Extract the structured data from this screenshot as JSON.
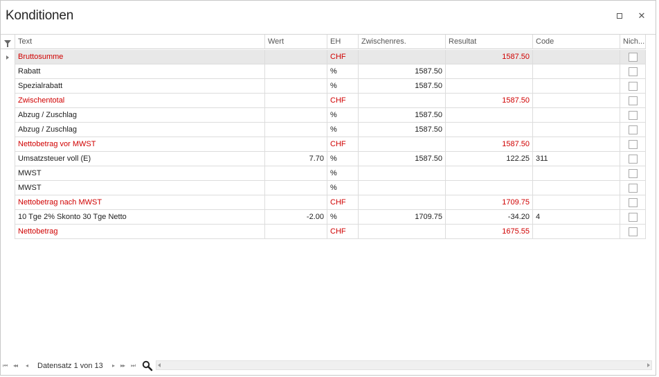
{
  "window": {
    "title": "Konditionen",
    "maximize_icon": "maximize-icon",
    "close_label": "✕"
  },
  "grid": {
    "columns": {
      "text": "Text",
      "wert": "Wert",
      "eh": "EH",
      "zwischenres": "Zwischenres.",
      "resultat": "Resultat",
      "code": "Code",
      "nich": "Nich..."
    },
    "highlight_color": "#d00000",
    "rows": [
      {
        "text": "Bruttosumme",
        "wert": "",
        "eh": "CHF",
        "zw": "",
        "res": "1587.50",
        "code": "",
        "checked": false,
        "highlight": true
      },
      {
        "text": "Rabatt",
        "wert": "",
        "eh": "%",
        "zw": "1587.50",
        "res": "",
        "code": "",
        "checked": false,
        "highlight": false
      },
      {
        "text": "Spezialrabatt",
        "wert": "",
        "eh": "%",
        "zw": "1587.50",
        "res": "",
        "code": "",
        "checked": false,
        "highlight": false
      },
      {
        "text": "Zwischentotal",
        "wert": "",
        "eh": "CHF",
        "zw": "",
        "res": "1587.50",
        "code": "",
        "checked": false,
        "highlight": true
      },
      {
        "text": "Abzug / Zuschlag",
        "wert": "",
        "eh": "%",
        "zw": "1587.50",
        "res": "",
        "code": "",
        "checked": false,
        "highlight": false
      },
      {
        "text": "Abzug / Zuschlag",
        "wert": "",
        "eh": "%",
        "zw": "1587.50",
        "res": "",
        "code": "",
        "checked": false,
        "highlight": false
      },
      {
        "text": "Nettobetrag vor MWST",
        "wert": "",
        "eh": "CHF",
        "zw": "",
        "res": "1587.50",
        "code": "",
        "checked": false,
        "highlight": true
      },
      {
        "text": "Umsatzsteuer voll (E)",
        "wert": "7.70",
        "eh": "%",
        "zw": "1587.50",
        "res": "122.25",
        "code": "311",
        "checked": false,
        "highlight": false
      },
      {
        "text": "MWST",
        "wert": "",
        "eh": "%",
        "zw": "",
        "res": "",
        "code": "",
        "checked": false,
        "highlight": false
      },
      {
        "text": "MWST",
        "wert": "",
        "eh": "%",
        "zw": "",
        "res": "",
        "code": "",
        "checked": false,
        "highlight": false
      },
      {
        "text": "Nettobetrag nach MWST",
        "wert": "",
        "eh": "CHF",
        "zw": "",
        "res": "1709.75",
        "code": "",
        "checked": false,
        "highlight": true
      },
      {
        "text": "10 Tge 2% Skonto 30 Tge Netto",
        "wert": "-2.00",
        "eh": "%",
        "zw": "1709.75",
        "res": "-34.20",
        "code": "4",
        "checked": false,
        "highlight": false
      },
      {
        "text": "Nettobetrag",
        "wert": "",
        "eh": "CHF",
        "zw": "",
        "res": "1675.55",
        "code": "",
        "checked": false,
        "highlight": true
      }
    ],
    "selected_row": 0
  },
  "footer": {
    "record_label": "Datensatz 1 von 13",
    "nav_first": "⏮",
    "nav_prev_page": "◂◂",
    "nav_prev": "◂",
    "nav_next": "▸",
    "nav_next_page": "▸▸",
    "nav_last": "⏭"
  }
}
